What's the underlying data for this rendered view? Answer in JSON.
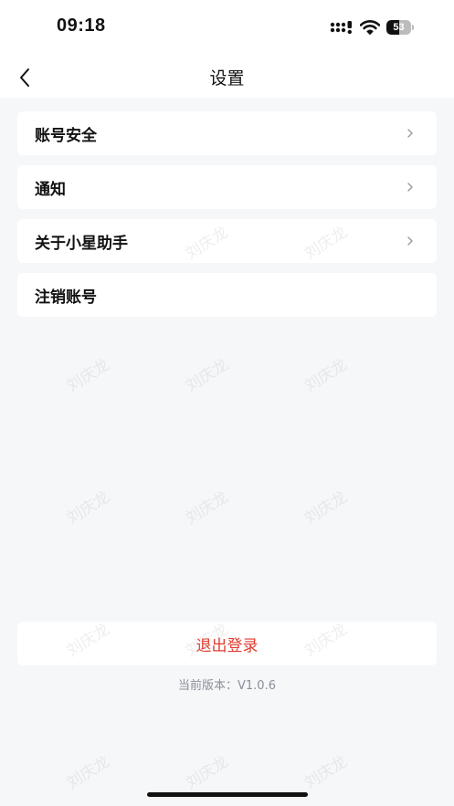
{
  "status_bar": {
    "time": "09:18",
    "battery": "53",
    "battery_level": 0.53,
    "icons": [
      "signal-icon",
      "wifi-icon",
      "battery-icon"
    ]
  },
  "header": {
    "back_icon": "chevron-left-icon",
    "title": "设置"
  },
  "menu": {
    "items": [
      {
        "label": "账号安全",
        "has_chevron": true
      },
      {
        "label": "通知",
        "has_chevron": true
      },
      {
        "label": "关于小星助手",
        "has_chevron": true
      },
      {
        "label": "注销账号",
        "has_chevron": false
      }
    ]
  },
  "logout": {
    "label": "退出登录",
    "color": "#e23b2e"
  },
  "version": {
    "text": "当前版本：V1.0.6"
  },
  "watermark": {
    "text": "刘庆龙"
  },
  "colors": {
    "background": "#f6f7f9",
    "card": "#ffffff",
    "text": "#111111",
    "secondary_text": "#8a8f99",
    "accent_red": "#e23b2e"
  }
}
